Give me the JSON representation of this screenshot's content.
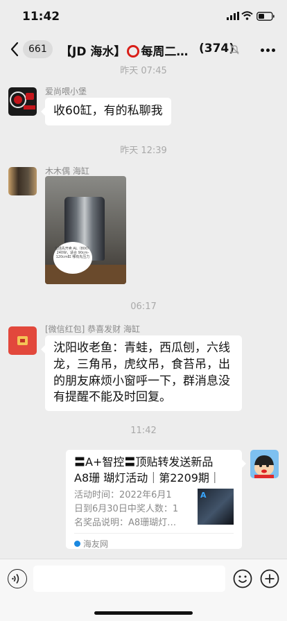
{
  "status_bar": {
    "time": "11:42"
  },
  "nav": {
    "back_count": "661",
    "title_left": "【JD 海水】",
    "title_right": "每周二…",
    "member_count": "(374)"
  },
  "messages": [
    {
      "time": "昨天 07:45",
      "sender": "爱尚喂小堡",
      "text": "收60缸，有的私聊我"
    },
    {
      "time": "昨天 12:39",
      "sender": "木木偶 海缸",
      "photo_caption": "包括先开卖 AL（800）240W，适合 90cm-120cm缸 哪有先压力"
    },
    {
      "time": "06:17",
      "sender": "[微信红包] 恭喜发财 海缸",
      "text": "沈阳收老鱼：青蛙，西瓜刨，六线龙，三角吊，虎纹吊，食苔吊，出的朋友麻烦小窗呼一下，群消息没有提醒不能及时回复。"
    },
    {
      "time": "11:42",
      "card": {
        "title_line1": "〓A+智控〓顶贴转发送新品",
        "title_line2": "A8珊 瑚灯活动｜第2209期｜",
        "desc_line1": "活动时间：2022年6月1",
        "desc_line2": "日到6月30日中奖人数：1",
        "desc_line3": "名奖品说明：A8珊瑚灯…",
        "thumb_logo": "A",
        "source": "海友网"
      }
    }
  ],
  "icons": [
    "back-icon",
    "mute-bell-icon",
    "more-icon",
    "voice-icon",
    "emoji-icon",
    "plus-icon"
  ],
  "colors": {
    "background": "#ededed",
    "bubble": "#ffffff",
    "title_ring": "#d91e18",
    "timestamp": "#a9a9a9"
  }
}
